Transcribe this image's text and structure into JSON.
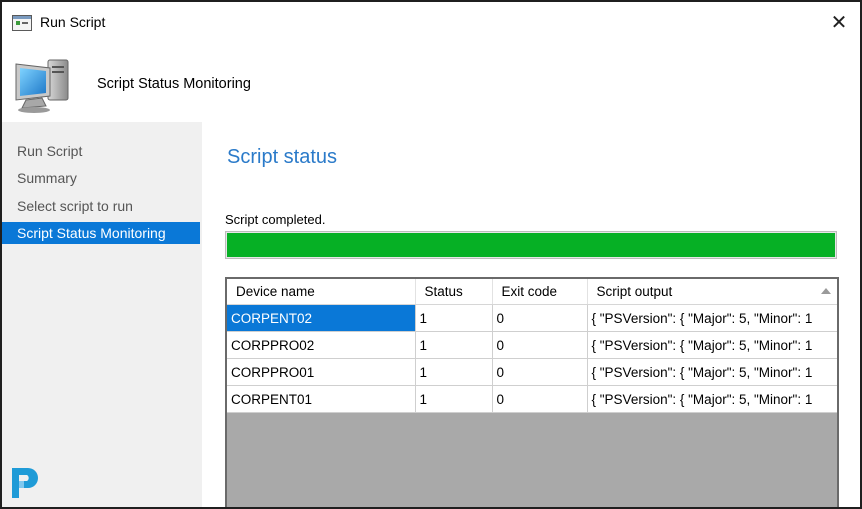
{
  "window": {
    "title": "Run Script"
  },
  "header": {
    "title": "Script Status Monitoring"
  },
  "sidebar": {
    "items": [
      {
        "label": "Run Script"
      },
      {
        "label": "Summary"
      },
      {
        "label": "Select script to run"
      },
      {
        "label": "Script Status Monitoring",
        "active": true
      }
    ]
  },
  "main": {
    "section_title": "Script status",
    "status_text": "Script completed.",
    "progress": 1.0,
    "progress_color": "#06b025",
    "accent_color": "#0a78d7"
  },
  "table": {
    "columns": [
      "Device name",
      "Status",
      "Exit code",
      "Script output"
    ],
    "rows": [
      [
        "CORPENT02",
        "1",
        "0",
        "{  \"PSVersion\":  {    \"Major\":  5,    \"Minor\":  1"
      ],
      [
        "CORPPRO02",
        "1",
        "0",
        "{  \"PSVersion\":  {    \"Major\":  5,    \"Minor\":  1"
      ],
      [
        "CORPPRO01",
        "1",
        "0",
        "{  \"PSVersion\":  {    \"Major\":  5,    \"Minor\":  1"
      ],
      [
        "CORPENT01",
        "1",
        "0",
        "{  \"PSVersion\":  {    \"Major\":  5,    \"Minor\":  1"
      ]
    ]
  }
}
